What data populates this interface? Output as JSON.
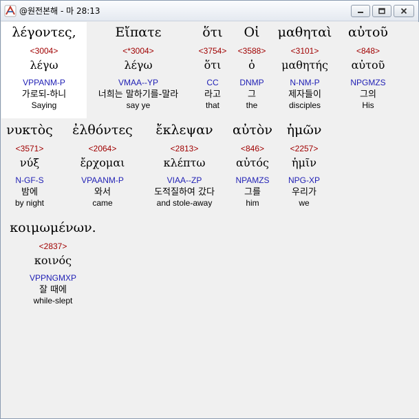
{
  "window": {
    "title": "@원전본해 - 마 28:13"
  },
  "words": [
    {
      "greek": "λέγοντες,",
      "strong": "<3004>",
      "lemma": "λέγω",
      "morph": "VPPANM-P",
      "korean": "가로되-하니",
      "english": "Saying"
    },
    {
      "greek": "Εἴπατε",
      "strong": "<*3004>",
      "lemma": "λέγω",
      "morph": "VMAA--YP",
      "korean": "너희는 말하기를-말라",
      "english": "say ye"
    },
    {
      "greek": "ὅτι",
      "strong": "<3754>",
      "lemma": "ὅτι",
      "morph": "CC",
      "korean": "라고",
      "english": "that"
    },
    {
      "greek": "Οἱ",
      "strong": "<3588>",
      "lemma": "ὁ",
      "morph": "DNMP",
      "korean": "그",
      "english": "the"
    },
    {
      "greek": "μαθηταὶ",
      "strong": "<3101>",
      "lemma": "μαθητής",
      "morph": "N-NM-P",
      "korean": "제자들이",
      "english": "disciples"
    },
    {
      "greek": "αὐτοῦ",
      "strong": "<848>",
      "lemma": "αὐτοῦ",
      "morph": "NPGMZS",
      "korean": "그의",
      "english": "His"
    },
    {
      "greek": "νυκτὸς",
      "strong": "<3571>",
      "lemma": "νύξ",
      "morph": "N-GF-S",
      "korean": "밤에",
      "english": "by night"
    },
    {
      "greek": "ἐλθόντες",
      "strong": "<2064>",
      "lemma": "ἔρχομαι",
      "morph": "VPAANM-P",
      "korean": "와서",
      "english": "came"
    },
    {
      "greek": "ἔκλεψαν",
      "strong": "<2813>",
      "lemma": "κλέπτω",
      "morph": "VIAA--ZP",
      "korean": "도적질하여 갔다",
      "english": "and stole-away"
    },
    {
      "greek": "αὐτὸν",
      "strong": "<846>",
      "lemma": "αὐτός",
      "morph": "NPAMZS",
      "korean": "그를",
      "english": "him"
    },
    {
      "greek": "ἡμῶν",
      "strong": "<2257>",
      "lemma": "ἡμῖν",
      "morph": "NPG-XP",
      "korean": "우리가",
      "english": "we"
    },
    {
      "greek": "κοιμωμένων.",
      "strong": "<2837>",
      "lemma": "κοινός",
      "morph": "VPPNGMXP",
      "korean": "잘 때에",
      "english": "while-slept"
    }
  ],
  "colors": {
    "strong": "#a00000",
    "morph": "#1e1eb4",
    "selected_bg": "#ffffff",
    "background": "#f0f0f0"
  },
  "icons": {
    "app": "app-logo-icon",
    "minimize": "minimize-icon",
    "maximize": "maximize-icon",
    "close": "close-icon"
  }
}
